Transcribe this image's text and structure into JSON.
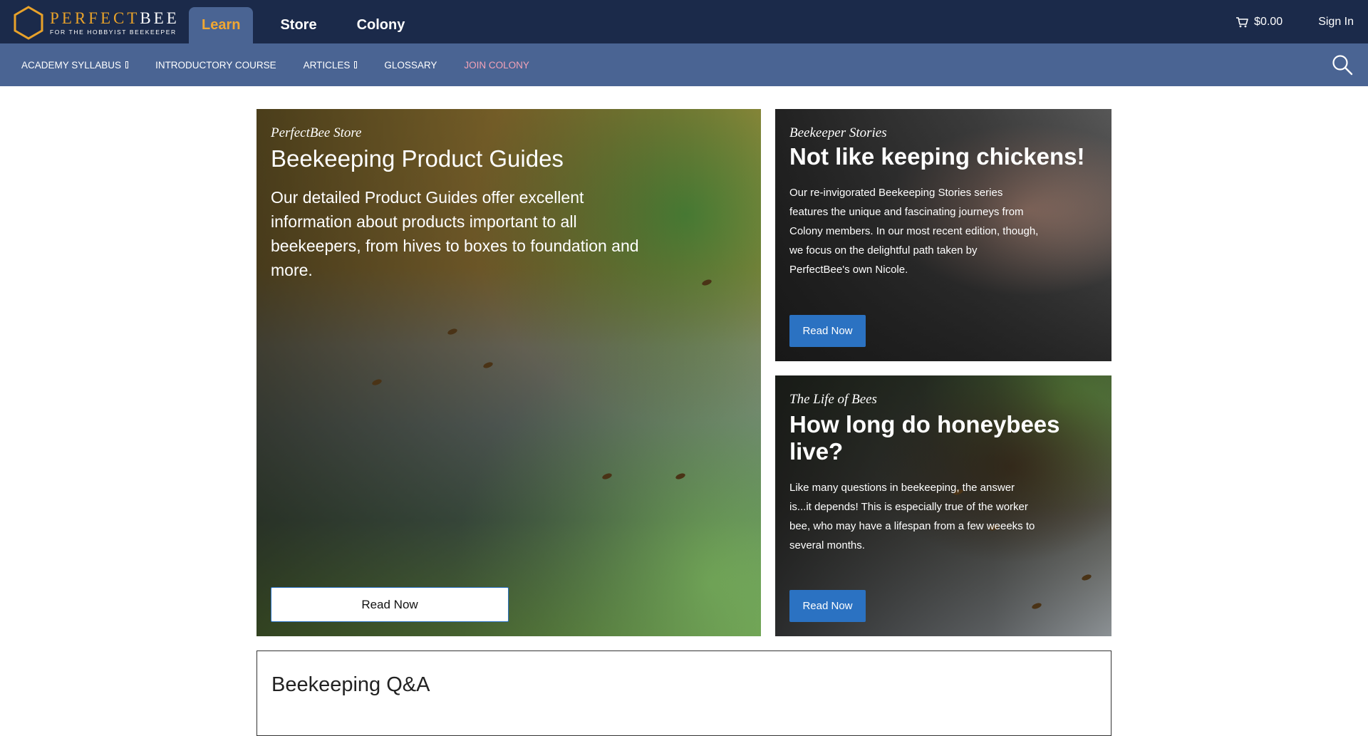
{
  "brand": {
    "name_part1": "PERFECT",
    "name_part2": "BEE",
    "tagline": "FOR THE HOBBYIST BEEKEEPER"
  },
  "main_nav": {
    "items": [
      {
        "label": "Learn",
        "active": true
      },
      {
        "label": "Store",
        "active": false
      },
      {
        "label": "Colony",
        "active": false
      }
    ]
  },
  "header_right": {
    "cart_amount": "$0.00",
    "sign_in": "Sign In"
  },
  "sub_nav": {
    "items": [
      {
        "label": "ACADEMY SYLLABUS",
        "has_dropdown": true
      },
      {
        "label": "INTRODUCTORY COURSE",
        "has_dropdown": false
      },
      {
        "label": "ARTICLES",
        "has_dropdown": true
      },
      {
        "label": "GLOSSARY",
        "has_dropdown": false
      },
      {
        "label": "JOIN COLONY",
        "has_dropdown": false,
        "highlight_color": "#f4a3b8"
      }
    ]
  },
  "cards": [
    {
      "kicker": "PerfectBee Store",
      "title": "Beekeeping Product Guides",
      "description": "Our detailed Product Guides offer excellent information about products important to all beekeepers, from hives to boxes to foundation and more.",
      "button": "Read Now"
    },
    {
      "kicker": "Beekeeper Stories",
      "title": "Not like keeping chickens!",
      "description": "Our re-invigorated Beekeeping Stories series features the unique and fascinating journeys from Colony members. In our most recent edition, though, we focus on the delightful path taken by PerfectBee's own Nicole.",
      "button": "Read Now"
    },
    {
      "kicker": "The Life of Bees",
      "title": "How long do honeybees live?",
      "description": "Like many questions in beekeeping, the answer is...it depends! This is especially true of the worker bee, who may have a lifespan from a few weeeks to several months.",
      "button": "Read Now"
    }
  ],
  "qa_section": {
    "title": "Beekeeping Q&A"
  },
  "colors": {
    "header_bg": "#1b2a4a",
    "subnav_bg": "#4a6493",
    "accent_orange": "#f0a732",
    "button_blue": "#2b72c2"
  }
}
